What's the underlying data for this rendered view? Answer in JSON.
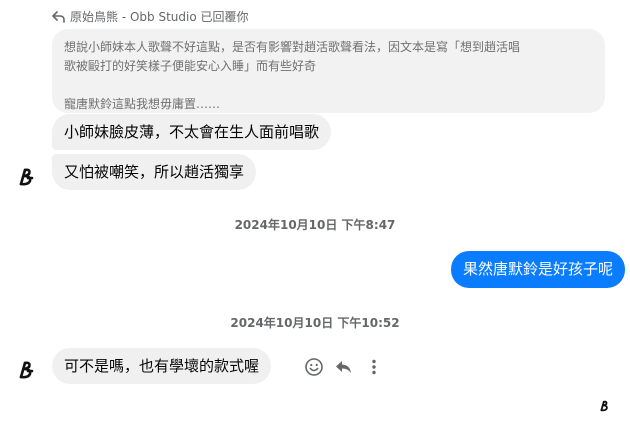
{
  "reply_context": {
    "icon": "reply-arrow-icon",
    "text": "原始鳥熊 - Obb Studio 已回覆你"
  },
  "quoted_message": {
    "lines": [
      "想說小師妹本人歌聲不好這點，是否有影響對趙活歌聲看法，因文本是寫「想到趙活唱",
      "歌被毆打的好笑樣子便能安心入睡」而有些好奇",
      "寵唐默鈴這點我想毋庸置……"
    ]
  },
  "messages": {
    "incoming_1": "小師妹臉皮薄，不太會在生人面前唱歌",
    "incoming_2": "又怕被嘲笑，所以趙活獨享",
    "outgoing_1": "果然唐默鈴是好孩子呢",
    "incoming_3": "可不是嗎，也有學壞的款式喔"
  },
  "timestamps": {
    "first": "2024年10月10日 下午8:47",
    "second": "2024年10月10日 下午10:52"
  },
  "message_actions": [
    "react-emoji-icon",
    "reply-icon",
    "more-options-icon"
  ],
  "colors": {
    "outgoing_bubble": "#0a7cff",
    "incoming_bubble": "#f0f0f0",
    "quoted_bubble": "#f2f2f2",
    "meta_text": "#65676b"
  }
}
